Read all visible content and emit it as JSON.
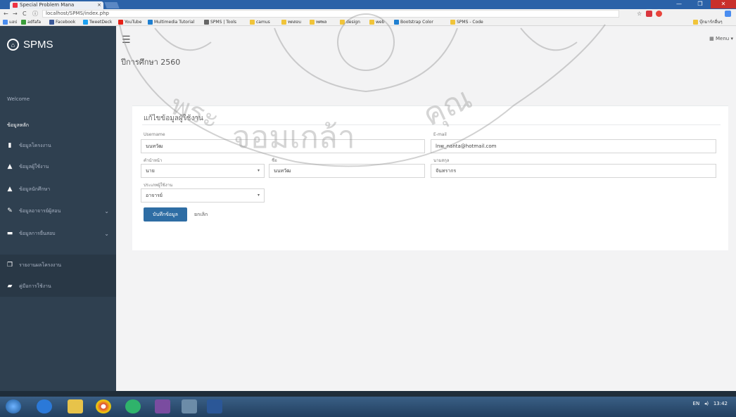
{
  "browser": {
    "tab_title": "Special Problem Mana",
    "tab_close": "×",
    "url": "localhost/SPMS/index.php",
    "window_controls": [
      "—",
      "❐",
      "✕"
    ],
    "bookmarks": [
      {
        "label": "แอป",
        "color": "#4a8df0"
      },
      {
        "label": "adfafa",
        "color": "#3a9d3a"
      },
      {
        "label": "Facebook",
        "color": "#3b5998"
      },
      {
        "label": "TweetDeck",
        "color": "#1da1f2"
      },
      {
        "label": "YouTube",
        "color": "#e62117"
      },
      {
        "label": "Multimedia Tutorial",
        "color": "#1f7fd0"
      },
      {
        "label": "SPMS | Tools",
        "color": "#666666"
      },
      {
        "label": "camus",
        "color": "#f0c43a"
      },
      {
        "label": "ทดสอบ",
        "color": "#f0c43a"
      },
      {
        "label": "ทศพล",
        "color": "#f0c43a"
      },
      {
        "label": "design",
        "color": "#f0c43a"
      },
      {
        "label": "web",
        "color": "#f0c43a"
      },
      {
        "label": "Bootstrap Color",
        "color": "#1f7fd0"
      },
      {
        "label": "SPMS - Code",
        "color": "#f0c43a"
      },
      {
        "label": "บุ๊กมาร์กอื่นๆ",
        "color": "#f0c43a"
      }
    ]
  },
  "sidebar": {
    "brand": "SPMS",
    "welcome": "Welcome",
    "section": "ข้อมูลหลัก",
    "items": [
      {
        "label": "ข้อมูลโครงงาน",
        "icon": "bookmark-icon",
        "has_submenu": false
      },
      {
        "label": "ข้อมูลผู้ใช้งาน",
        "icon": "user-icon",
        "has_submenu": false
      },
      {
        "label": "ข้อมูลนักศึกษา",
        "icon": "user-icon",
        "has_submenu": false
      },
      {
        "label": "ข้อมูลอาจารย์ผู้สอน",
        "icon": "pencil-icon",
        "has_submenu": true
      },
      {
        "label": "ข้อมูลการยื่นสอบ",
        "icon": "folder-icon",
        "has_submenu": true
      },
      {
        "label": "รายงานผลโครงงาน",
        "icon": "file-icon",
        "has_submenu": false
      },
      {
        "label": "คู่มือการใช้งาน",
        "icon": "book-icon",
        "has_submenu": false
      }
    ]
  },
  "topbar": {
    "hamburger": "☰",
    "menu_label": "Menu"
  },
  "page": {
    "title": "ปีการศึกษา 2560"
  },
  "form": {
    "card_title": "แก้ไขข้อมูลผู้ใช้งาน",
    "username_label": "Username",
    "username_value": "นนทวัฒ",
    "email_label": "E-mail",
    "email_value": "lnw_nanta@hotmail.com",
    "prefix_label": "คำนำหน้า",
    "prefix_value": "นาย",
    "firstname_label": "ชื่อ",
    "firstname_value": "นนทวัฒ",
    "lastname_label": "นามสกุล",
    "lastname_value": "จันทรากร",
    "usertype_label": "ประเภทผู้ใช้งาน",
    "usertype_value": "อาจารย์",
    "save_label": "บันทึกข้อมูล",
    "cancel_label": "ยกเลิก"
  },
  "taskbar": {
    "lang": "EN",
    "time": "13:42"
  },
  "colors": {
    "sidebar_bg": "#2f4050",
    "primary_button": "#2e6da4"
  }
}
